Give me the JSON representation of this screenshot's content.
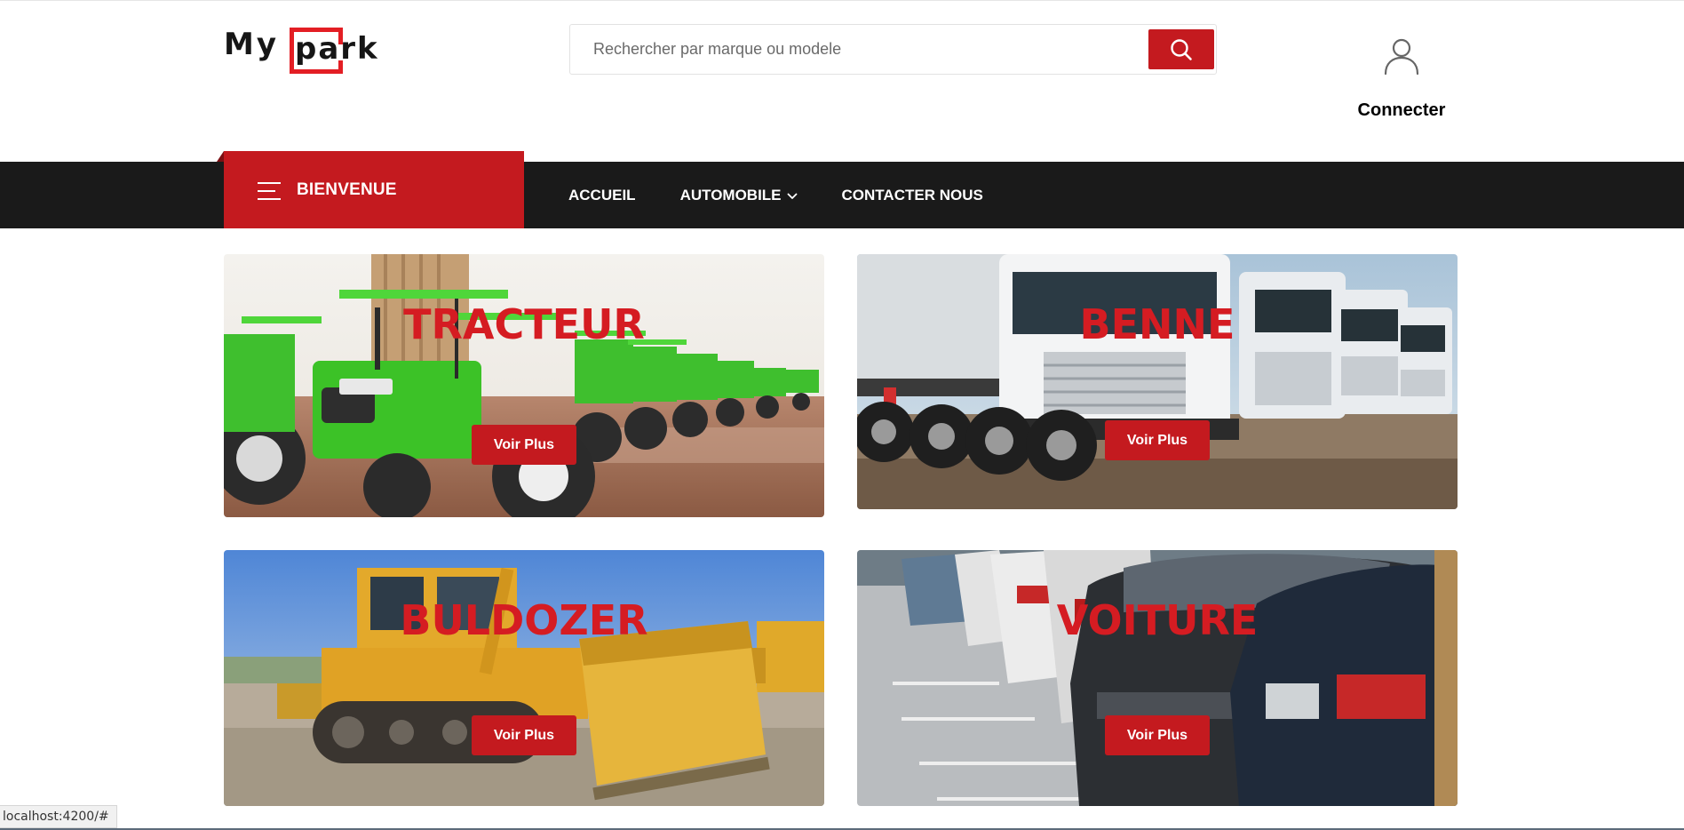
{
  "header": {
    "logo": {
      "part1": "My",
      "part2": "park"
    },
    "search": {
      "placeholder": "Rechercher par marque ou modele",
      "value": ""
    },
    "account": {
      "label": "Connecter"
    }
  },
  "nav": {
    "welcome_label": "BIENVENUE",
    "links": [
      {
        "label": "ACCUEIL"
      },
      {
        "label": "AUTOMOBILE",
        "has_dropdown": true
      },
      {
        "label": "CONTACTER NOUS"
      }
    ]
  },
  "categories": [
    {
      "title": "TRACTEUR",
      "button": "Voir Plus"
    },
    {
      "title": "BENNE",
      "button": "Voir Plus"
    },
    {
      "title": "BULDOZER",
      "button": "Voir Plus"
    },
    {
      "title": "VOITURE",
      "button": "Voir Plus"
    }
  ],
  "statusbar": {
    "text": "localhost:4200/#"
  },
  "colors": {
    "accent": "#c41a1f",
    "nav_background": "#1a1a1a",
    "title_red": "#d51c22"
  },
  "icons": [
    "search-icon",
    "user-icon",
    "menu-icon",
    "chevron-down-icon"
  ]
}
